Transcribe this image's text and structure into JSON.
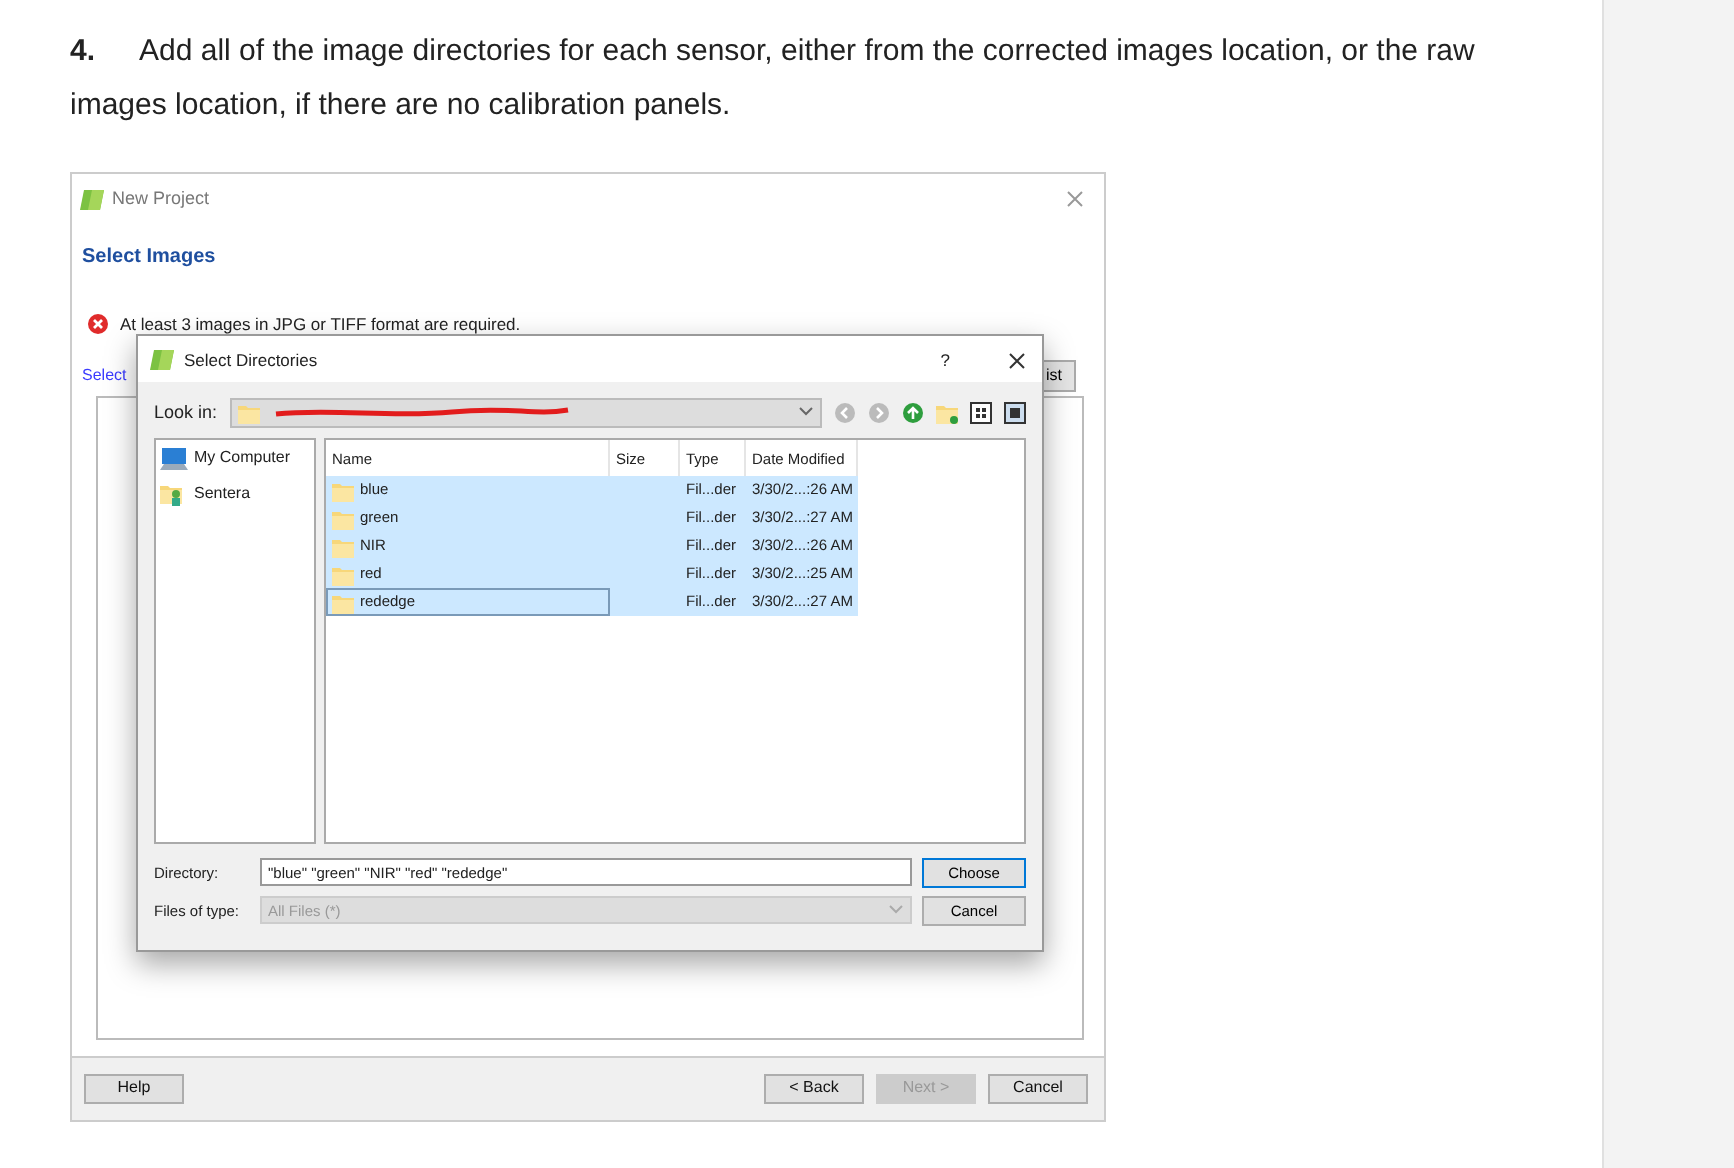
{
  "instruction": {
    "number": "4.",
    "text": "Add all of the image directories for each sensor, either from the corrected images location, or the raw images location, if there are no calibration panels."
  },
  "project_window": {
    "title": "New Project",
    "heading": "Select Images",
    "error": "At least 3 images in JPG or TIFF format are required.",
    "select_label": "Select",
    "list_button": "ist",
    "buttons": [
      {
        "label": "Help",
        "disabled": false
      },
      {
        "label": "< Back",
        "disabled": false
      },
      {
        "label": "Next >",
        "disabled": true
      },
      {
        "label": "Cancel",
        "disabled": false
      }
    ]
  },
  "dialog": {
    "title": "Select Directories",
    "help": "?",
    "look_in_label": "Look in:",
    "places": [
      {
        "label": "My Computer",
        "kind": "computer"
      },
      {
        "label": "Sentera",
        "kind": "user"
      }
    ],
    "columns": [
      "Name",
      "Size",
      "Type",
      "Date Modified"
    ],
    "rows": [
      {
        "name": "blue",
        "type": "Fil...der",
        "date": "3/30/2...:26 AM",
        "selected": true,
        "focused": false
      },
      {
        "name": "green",
        "type": "Fil...der",
        "date": "3/30/2...:27 AM",
        "selected": true,
        "focused": false
      },
      {
        "name": "NIR",
        "type": "Fil...der",
        "date": "3/30/2...:26 AM",
        "selected": true,
        "focused": false
      },
      {
        "name": "red",
        "type": "Fil...der",
        "date": "3/30/2...:25 AM",
        "selected": true,
        "focused": false
      },
      {
        "name": "rededge",
        "type": "Fil...der",
        "date": "3/30/2...:27 AM",
        "selected": true,
        "focused": true
      }
    ],
    "directory_label": "Directory:",
    "directory_value": "\"blue\" \"green\" \"NIR\" \"red\" \"rededge\"",
    "file_type_label": "Files of type:",
    "file_type_value": "All Files (*)",
    "file_type_disabled": true,
    "buttons": [
      {
        "label": "Choose",
        "default": true
      },
      {
        "label": "Cancel",
        "default": false
      }
    ]
  }
}
